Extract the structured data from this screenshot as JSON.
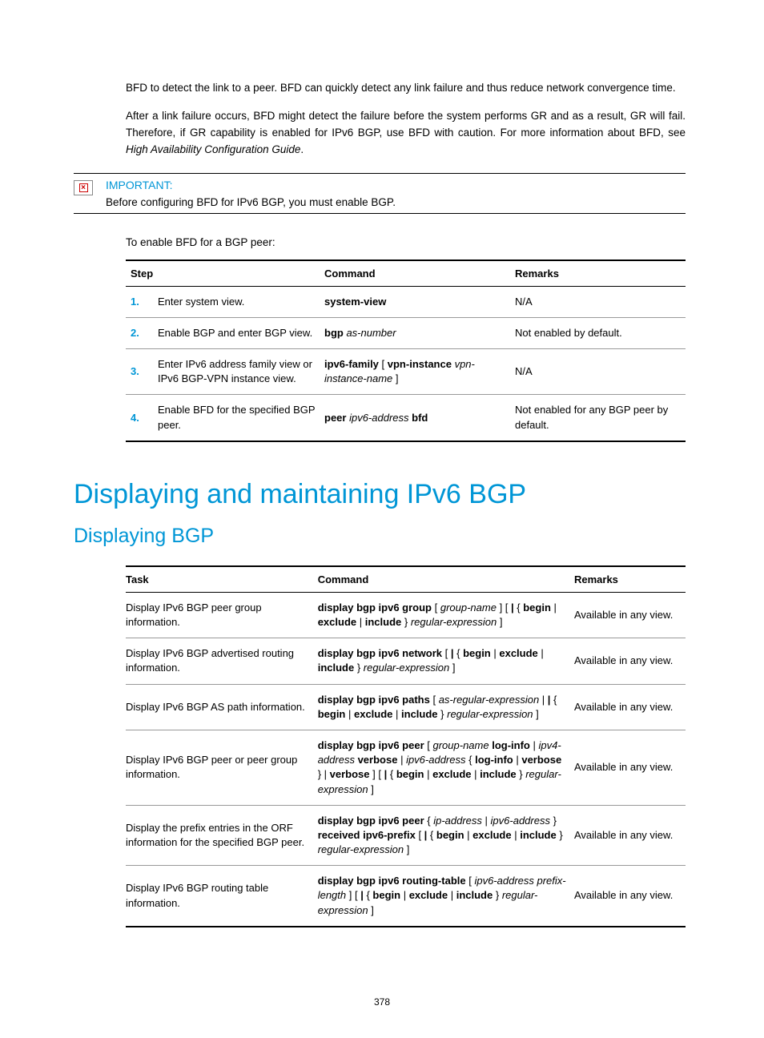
{
  "paragraphs": {
    "p1": "BFD to detect the link to a peer. BFD can quickly detect any link failure and thus reduce network convergence time.",
    "p2_a": "After a link failure occurs, BFD might detect the failure before the system performs GR and as a result, GR will fail. Therefore, if GR capability is enabled for IPv6 BGP, use BFD with caution. For more information about BFD, see ",
    "p2_b": "High Availability Configuration Guide",
    "p2_c": "."
  },
  "important": {
    "label": "IMPORTANT:",
    "text": "Before configuring BFD for IPv6 BGP, you must enable BGP."
  },
  "lead_in": "To enable BFD for a BGP peer:",
  "table1": {
    "headers": {
      "step": "Step",
      "command": "Command",
      "remarks": "Remarks"
    },
    "rows": [
      {
        "num": "1.",
        "step": "Enter system view.",
        "cmd_bold1": "system-view",
        "remarks": "N/A"
      },
      {
        "num": "2.",
        "step": "Enable BGP and enter BGP view.",
        "cmd_bold1": "bgp",
        "cmd_ital1": " as-number",
        "remarks": "Not enabled by default."
      },
      {
        "num": "3.",
        "step": "Enter IPv6 address family view or IPv6 BGP-VPN instance view.",
        "cmd_bold1": "ipv6-family",
        "cmd_plain1": " [ ",
        "cmd_bold2": "vpn-instance",
        "cmd_ital1": " vpn-instance-name",
        "cmd_plain2": " ]",
        "remarks": "N/A"
      },
      {
        "num": "4.",
        "step": "Enable BFD for the specified BGP peer.",
        "cmd_bold1": "peer",
        "cmd_ital1": " ipv6-address",
        "cmd_bold2": " bfd",
        "remarks": "Not enabled for any BGP peer by default."
      }
    ]
  },
  "h1": "Displaying and maintaining IPv6 BGP",
  "h2": "Displaying BGP",
  "table2": {
    "headers": {
      "task": "Task",
      "command": "Command",
      "remarks": "Remarks"
    },
    "rows": [
      {
        "task": "Display IPv6 BGP peer group information.",
        "cmd_parts": [
          {
            "b": "display bgp ipv6 group"
          },
          {
            "p": " [ "
          },
          {
            "i": "group-name"
          },
          {
            "p": " ] [ "
          },
          {
            "b": "|"
          },
          {
            "p": " { "
          },
          {
            "b": "begin"
          },
          {
            "p": " | "
          },
          {
            "b": "exclude"
          },
          {
            "p": " | "
          },
          {
            "b": "include"
          },
          {
            "p": " } "
          },
          {
            "i": "regular-expression"
          },
          {
            "p": " ]"
          }
        ],
        "remarks": "Available in any view."
      },
      {
        "task": "Display IPv6 BGP advertised routing information.",
        "cmd_parts": [
          {
            "b": "display bgp ipv6 network"
          },
          {
            "p": " [ "
          },
          {
            "b": "|"
          },
          {
            "p": " { "
          },
          {
            "b": "begin"
          },
          {
            "p": " | "
          },
          {
            "b": "exclude"
          },
          {
            "p": " | "
          },
          {
            "b": "include"
          },
          {
            "p": " } "
          },
          {
            "i": "regular-expression"
          },
          {
            "p": " ]"
          }
        ],
        "remarks": "Available in any view."
      },
      {
        "task": "Display IPv6 BGP AS path information.",
        "cmd_parts": [
          {
            "b": "display bgp ipv6 paths"
          },
          {
            "p": " [ "
          },
          {
            "i": "as-regular-expression"
          },
          {
            "p": " | "
          },
          {
            "b": "|"
          },
          {
            "p": " { "
          },
          {
            "b": "begin"
          },
          {
            "p": " | "
          },
          {
            "b": "exclude"
          },
          {
            "p": " | "
          },
          {
            "b": "include"
          },
          {
            "p": " } "
          },
          {
            "i": "regular-expression"
          },
          {
            "p": " ]"
          }
        ],
        "remarks": "Available in any view."
      },
      {
        "task": "Display IPv6 BGP peer or peer group information.",
        "cmd_parts": [
          {
            "b": "display bgp ipv6 peer"
          },
          {
            "p": " [ "
          },
          {
            "i": "group-name"
          },
          {
            "p": " "
          },
          {
            "b": "log-info"
          },
          {
            "p": " | "
          },
          {
            "i": "ipv4-address"
          },
          {
            "p": " "
          },
          {
            "b": "verbose"
          },
          {
            "p": " | "
          },
          {
            "i": "ipv6-address"
          },
          {
            "p": " { "
          },
          {
            "b": "log-info"
          },
          {
            "p": " | "
          },
          {
            "b": "verbose"
          },
          {
            "p": " } | "
          },
          {
            "b": "verbose"
          },
          {
            "p": " ] [ "
          },
          {
            "b": "|"
          },
          {
            "p": " { "
          },
          {
            "b": "begin"
          },
          {
            "p": " | "
          },
          {
            "b": "exclude"
          },
          {
            "p": " | "
          },
          {
            "b": "include"
          },
          {
            "p": " } "
          },
          {
            "i": "regular-expression"
          },
          {
            "p": " ]"
          }
        ],
        "remarks": "Available in any view."
      },
      {
        "task": "Display the prefix entries in the ORF information for the specified BGP peer.",
        "cmd_parts": [
          {
            "b": "display bgp ipv6 peer"
          },
          {
            "p": " { "
          },
          {
            "i": "ip-address"
          },
          {
            "p": " | "
          },
          {
            "i": "ipv6-address"
          },
          {
            "p": " } "
          },
          {
            "b": "received ipv6-prefix"
          },
          {
            "p": " [ "
          },
          {
            "b": "|"
          },
          {
            "p": " { "
          },
          {
            "b": "begin"
          },
          {
            "p": " | "
          },
          {
            "b": "exclude"
          },
          {
            "p": " | "
          },
          {
            "b": "include"
          },
          {
            "p": " } "
          },
          {
            "i": "regular-expression"
          },
          {
            "p": " ]"
          }
        ],
        "remarks": "Available in any view."
      },
      {
        "task": "Display IPv6 BGP routing table information.",
        "cmd_parts": [
          {
            "b": "display bgp ipv6 routing-table"
          },
          {
            "p": " [ "
          },
          {
            "i": "ipv6-address prefix-length"
          },
          {
            "p": " ] [ "
          },
          {
            "b": "|"
          },
          {
            "p": " { "
          },
          {
            "b": "begin"
          },
          {
            "p": " | "
          },
          {
            "b": "exclude"
          },
          {
            "p": " | "
          },
          {
            "b": "include"
          },
          {
            "p": " } "
          },
          {
            "i": "regular-expression"
          },
          {
            "p": " ]"
          }
        ],
        "remarks": "Available in any view."
      }
    ]
  },
  "page_number": "378"
}
